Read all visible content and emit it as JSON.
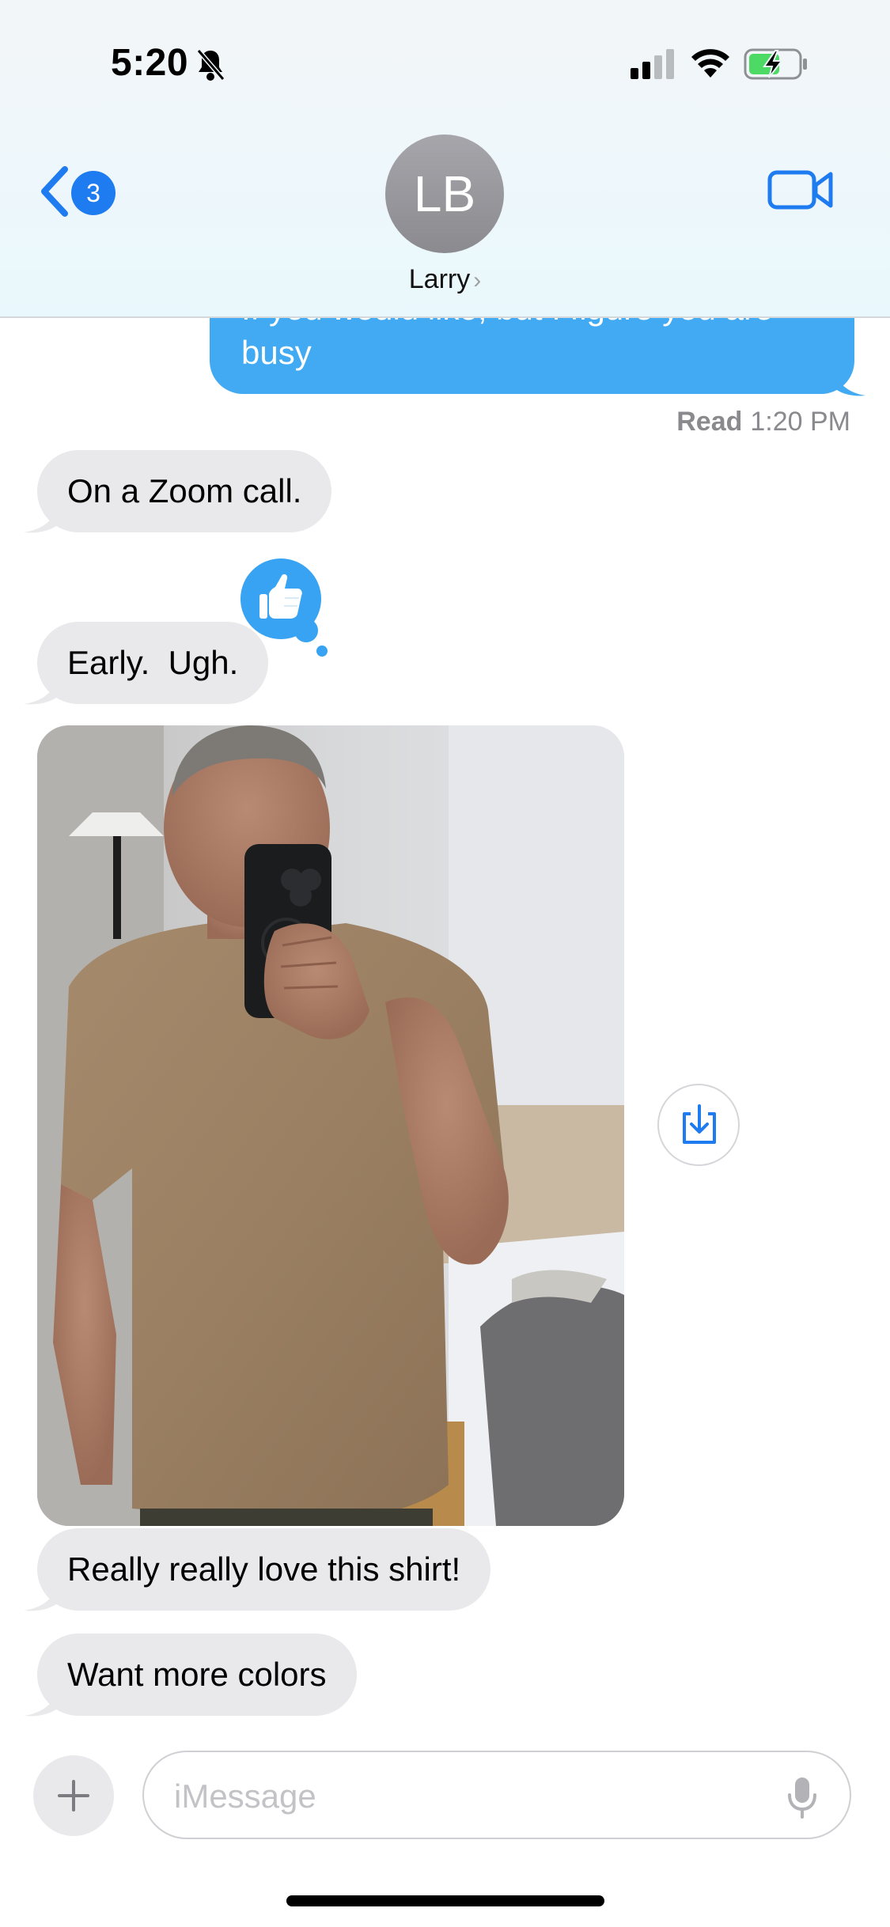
{
  "status_bar": {
    "time": "5:20",
    "icons": [
      "bell-slash-icon",
      "cellular-signal-icon",
      "wifi-icon",
      "battery-charging-icon"
    ],
    "battery_color": "#4cd964"
  },
  "header": {
    "back_badge_count": "3",
    "avatar_initials": "LB",
    "contact_name": "Larry",
    "contact_chevron": "›",
    "accent_color": "#1f7bf0"
  },
  "conversation": {
    "sent_message": {
      "text_partial": "If you would like, but I figure you are",
      "text": "busy",
      "color": "#41aaf2"
    },
    "read_receipt": {
      "label": "Read",
      "time": "1:20 PM"
    },
    "received_messages": [
      {
        "text": "On a Zoom call."
      },
      {
        "text": "Early.  Ugh.",
        "tapback": "thumbs-up-icon"
      },
      {
        "text": "Really really love this shirt!"
      },
      {
        "text": "Want more colors"
      }
    ],
    "received_bubble_color": "#e9e9eb"
  },
  "composer": {
    "placeholder": "iMessage",
    "value": ""
  }
}
